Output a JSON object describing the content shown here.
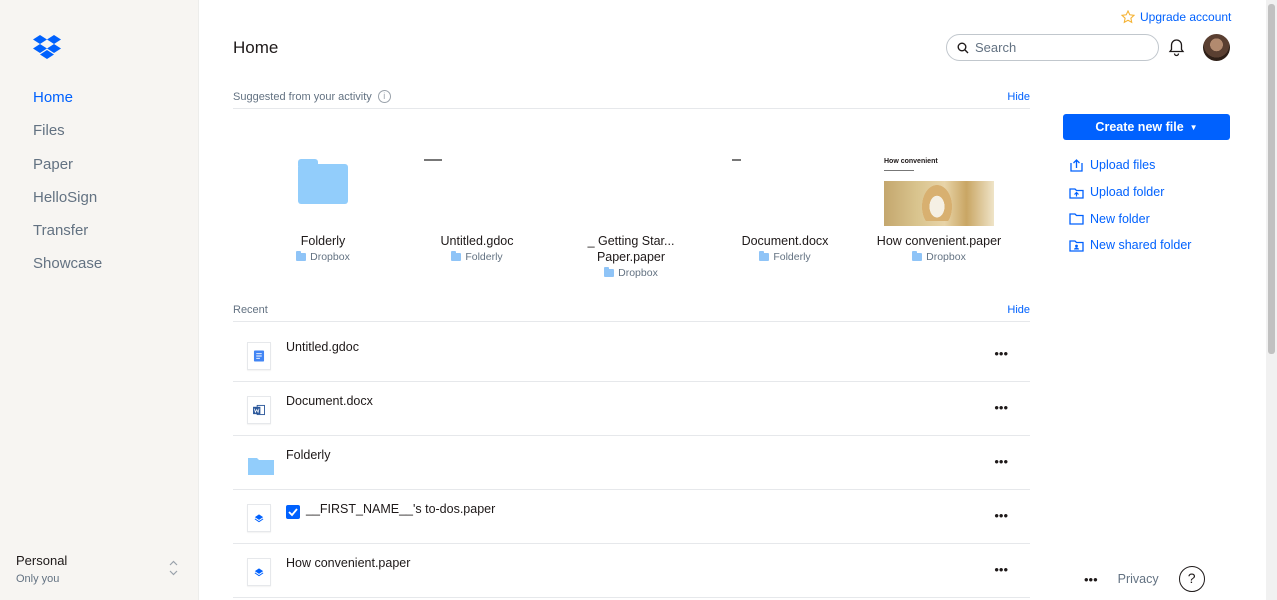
{
  "sidebar": {
    "nav": [
      "Home",
      "Files",
      "Paper",
      "HelloSign",
      "Transfer",
      "Showcase"
    ],
    "active": "Home",
    "account": {
      "name": "Personal",
      "sub": "Only you"
    }
  },
  "header": {
    "upgrade": "Upgrade account",
    "title": "Home",
    "search_placeholder": "Search"
  },
  "suggested": {
    "label": "Suggested from your activity",
    "hide": "Hide",
    "items": [
      {
        "title": "Folderly",
        "location": "Dropbox"
      },
      {
        "title": "Untitled.gdoc",
        "location": "Folderly"
      },
      {
        "title": "_ Getting Star... Paper.paper",
        "location": "Dropbox"
      },
      {
        "title": "Document.docx",
        "location": "Folderly"
      },
      {
        "title": "How convenient.paper",
        "location": "Dropbox",
        "thumb_caption": "How convenient"
      }
    ]
  },
  "recent": {
    "label": "Recent",
    "hide": "Hide",
    "items": [
      {
        "name": "Untitled.gdoc",
        "icon": "gdoc-icon"
      },
      {
        "name": "Document.docx",
        "icon": "word-icon"
      },
      {
        "name": "Folderly",
        "icon": "folder-icon"
      },
      {
        "name": "__FIRST_NAME__'s to-dos.paper",
        "icon": "paper-icon"
      },
      {
        "name": "How convenient.paper",
        "icon": "paper-icon"
      }
    ],
    "more": "•••"
  },
  "actions": {
    "create": "Create new file",
    "items": [
      "Upload files",
      "Upload folder",
      "New folder",
      "New shared folder"
    ]
  },
  "footer": {
    "dots": "•••",
    "privacy": "Privacy",
    "help": "?"
  },
  "colors": {
    "accent": "#0061fe",
    "sidebar_bg": "#f7f5f2",
    "folder": "#92cdfb"
  }
}
